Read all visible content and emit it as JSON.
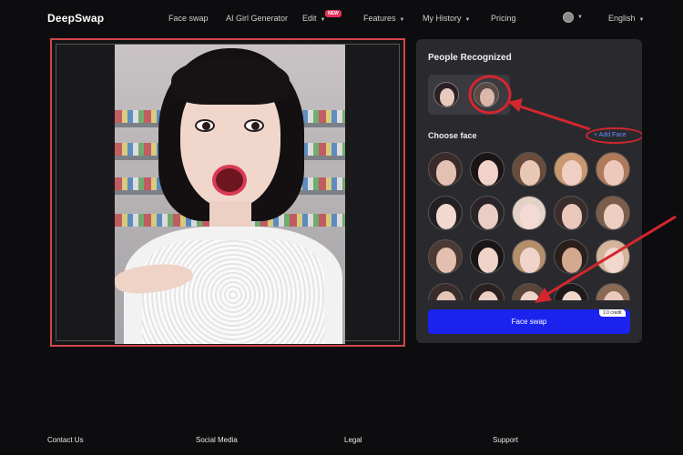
{
  "nav": {
    "logo": "DeepSwap",
    "items": [
      {
        "label": "Face swap"
      },
      {
        "label": "AI Girl Generator"
      },
      {
        "label": "Edit",
        "badge": "NEW"
      },
      {
        "label": "Features"
      },
      {
        "label": "My History"
      },
      {
        "label": "Pricing"
      }
    ],
    "language": "English",
    "avatar_icon": "user-avatar-icon",
    "caret_icon": "chevron-down-icon"
  },
  "panel": {
    "recognized_title": "People Recognized",
    "choose_title": "Choose face",
    "add_face_label": "+ Add Face",
    "swap_button_label": "Face swap",
    "credit_label": "1.0 credit",
    "recognized_faces": [
      {
        "skin": "#e8c9be",
        "hair": "#2a1f22"
      },
      {
        "skin": "#d9b7ab",
        "hair": "#5b4a44"
      }
    ],
    "choose_faces": [
      {
        "skin": "#e2c0b2",
        "hair": "#3a2b2a"
      },
      {
        "skin": "#f0d2c8",
        "hair": "#1a1416"
      },
      {
        "skin": "#e8c7b5",
        "hair": "#6a4c3c"
      },
      {
        "skin": "#efcfc4",
        "hair": "#c99870"
      },
      {
        "skin": "#ecc9bc",
        "hair": "#b07a5a"
      },
      {
        "skin": "#f2d8cf",
        "hair": "#222022"
      },
      {
        "skin": "#eacdc4",
        "hair": "#2a2428"
      },
      {
        "skin": "#f3dad2",
        "hair": "#e4d2c6"
      },
      {
        "skin": "#e9c8bb",
        "hair": "#3b2d2b"
      },
      {
        "skin": "#edcfc2",
        "hair": "#7a5d4a"
      },
      {
        "skin": "#e3bfb0",
        "hair": "#4a3a33"
      },
      {
        "skin": "#efd3c9",
        "hair": "#191517"
      },
      {
        "skin": "#f0d4cb",
        "hair": "#b58f6c"
      },
      {
        "skin": "#d2a88f",
        "hair": "#2b1f1b"
      },
      {
        "skin": "#f2d7cd",
        "hair": "#d4b49a"
      },
      {
        "skin": "#e6c4b6",
        "hair": "#3a2c2a"
      },
      {
        "skin": "#ecd0c5",
        "hair": "#2a2022"
      },
      {
        "skin": "#efd2c8",
        "hair": "#5a4538"
      },
      {
        "skin": "#f1d6cc",
        "hair": "#1e1a1c"
      },
      {
        "skin": "#e9cabd",
        "hair": "#8a6a55"
      }
    ]
  },
  "footer": {
    "items": [
      "Contact Us",
      "Social Media",
      "Legal",
      "Support"
    ]
  },
  "colors": {
    "accent": "#1b22ee",
    "annotation": "#d3262e",
    "badge": "#e5325a",
    "link": "#6b8cff"
  }
}
